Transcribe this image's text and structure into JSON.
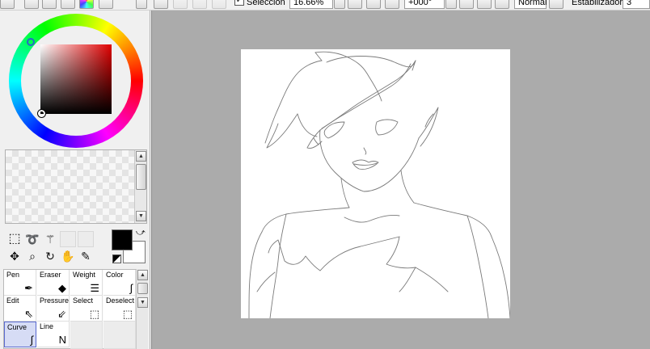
{
  "toolbar": {
    "selection_label": "Selección",
    "selection_checked": true,
    "zoom": "16.66%",
    "rotation": "+000°",
    "blend_mode": "Normal",
    "stabilizer_label": "Estabilizador",
    "stabilizer_value": "3"
  },
  "left_panel": {
    "fg_color": "#000000",
    "bg_color": "#ffffff",
    "hue_color": "#e00000"
  },
  "brush_tools": [
    {
      "label": "Pen",
      "icon": "pen-icon",
      "selected": false
    },
    {
      "label": "Eraser",
      "icon": "eraser-icon",
      "selected": false
    },
    {
      "label": "Weight",
      "icon": "weight-icon",
      "selected": false
    },
    {
      "label": "Color",
      "icon": "color-icon",
      "selected": false
    },
    {
      "label": "Edit",
      "icon": "edit-arrow-icon",
      "selected": false
    },
    {
      "label": "Pressure",
      "icon": "pressure-icon",
      "selected": false
    },
    {
      "label": "Select",
      "icon": "select-icon",
      "selected": false
    },
    {
      "label": "Deselect",
      "icon": "deselect-icon",
      "selected": false
    },
    {
      "label": "Curve",
      "icon": "curve-icon",
      "selected": true
    },
    {
      "label": "Line",
      "icon": "line-icon",
      "selected": false
    }
  ],
  "icons": {
    "selection_tools": [
      "rect-select-icon",
      "lasso-icon",
      "magic-wand-icon"
    ],
    "view_tools": [
      "move-icon",
      "zoom-icon",
      "rotate-icon",
      "hand-icon",
      "eyedropper-icon"
    ]
  }
}
